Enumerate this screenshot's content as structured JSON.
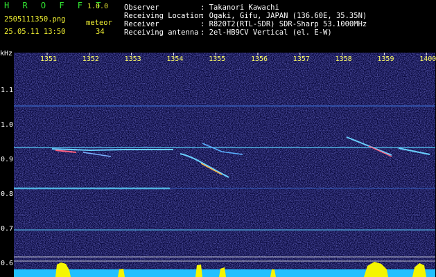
{
  "app": {
    "title": "H R O F F T",
    "version": "1.0.0",
    "filename": "2505111350.png",
    "datetime": "25.05.11 13:50",
    "meteor_label": "meteor",
    "meteor_count": "34"
  },
  "station": {
    "observer_label": "Observer",
    "observer_value": ": Takanori Kawachi",
    "location_label": "Receiving Location",
    "location_value": ": Ogaki, Gifu, JAPAN (136.60E, 35.35N)",
    "receiver_label": "Receiver",
    "receiver_value": ": R820T2(RTL-SDR) SDR-Sharp 53.1000MHz",
    "antenna_label": "Receiving antenna",
    "antenna_value": ": 2el-HB9CV Vertical (el. E-W)"
  },
  "axes": {
    "y_unit": "kHz",
    "y_ticks": [
      "1.1",
      "1.0",
      "0.9",
      "0.8",
      "0.7",
      "0.6"
    ],
    "x_ticks": [
      "1351",
      "1352",
      "1353",
      "1354",
      "1355",
      "1356",
      "1357",
      "1358",
      "1359",
      "1400"
    ]
  },
  "colors": {
    "background": "#000000",
    "spectrogram_bg": "#06063a",
    "title_green": "#32e632",
    "label_yellow": "#f0f032",
    "carrier_cyan": "#4fb0e0",
    "meteor_trace": "#6ad0ff",
    "level_bar": "#f5f500"
  }
}
